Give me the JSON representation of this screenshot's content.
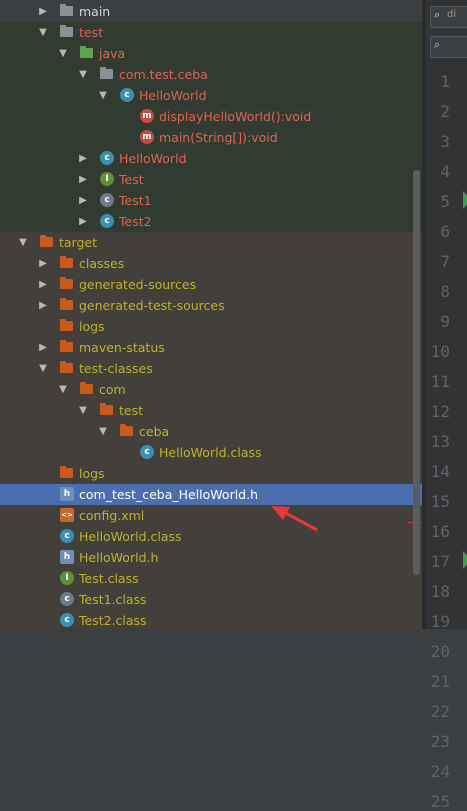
{
  "tree": {
    "rows": [
      {
        "label": "main",
        "kind": "folder-gray",
        "color": "white",
        "indent": 0,
        "arrow": "right"
      },
      {
        "label": "test",
        "kind": "folder-gray",
        "color": "red",
        "indent": 0,
        "arrow": "down"
      },
      {
        "label": "java",
        "kind": "folder-green",
        "color": "red",
        "indent": 1,
        "arrow": "down"
      },
      {
        "label": "com.test.ceba",
        "kind": "package",
        "color": "red",
        "indent": 2,
        "arrow": "down"
      },
      {
        "label": "HelloWorld",
        "kind": "class",
        "color": "red",
        "indent": 3,
        "arrow": "down"
      },
      {
        "label": "displayHelloWorld():void",
        "kind": "method",
        "color": "red",
        "indent": 4,
        "arrow": ""
      },
      {
        "label": "main(String[]):void",
        "kind": "method",
        "color": "red",
        "indent": 4,
        "arrow": ""
      },
      {
        "label": "HelloWorld",
        "kind": "class",
        "color": "red",
        "indent": 3,
        "arrow": "right",
        "indent_override": 2
      },
      {
        "label": "Test",
        "kind": "interface",
        "color": "red",
        "indent": 2,
        "arrow": "right"
      },
      {
        "label": "Test1",
        "kind": "abstract",
        "color": "red",
        "indent": 2,
        "arrow": "right"
      },
      {
        "label": "Test2",
        "kind": "class",
        "color": "red",
        "indent": 2,
        "arrow": "right"
      },
      {
        "label": "target",
        "kind": "folder-orange",
        "color": "olive",
        "indent": -1,
        "arrow": "down"
      },
      {
        "label": "classes",
        "kind": "folder-orange",
        "color": "olive",
        "indent": 0,
        "arrow": "right"
      },
      {
        "label": "generated-sources",
        "kind": "folder-orange",
        "color": "olive",
        "indent": 0,
        "arrow": "right"
      },
      {
        "label": "generated-test-sources",
        "kind": "folder-orange",
        "color": "olive",
        "indent": 0,
        "arrow": "right"
      },
      {
        "label": "logs",
        "kind": "folder-orange",
        "color": "olive",
        "indent": 0,
        "arrow": ""
      },
      {
        "label": "maven-status",
        "kind": "folder-orange",
        "color": "olive",
        "indent": 0,
        "arrow": "right"
      },
      {
        "label": "test-classes",
        "kind": "folder-orange",
        "color": "olive",
        "indent": 0,
        "arrow": "down"
      },
      {
        "label": "com",
        "kind": "folder-orange",
        "color": "olive",
        "indent": 1,
        "arrow": "down"
      },
      {
        "label": "test",
        "kind": "folder-orange",
        "color": "olive",
        "indent": 2,
        "arrow": "down"
      },
      {
        "label": "ceba",
        "kind": "folder-orange",
        "color": "olive",
        "indent": 3,
        "arrow": "down"
      },
      {
        "label": "HelloWorld.class",
        "kind": "class-file",
        "color": "olive",
        "indent": 4,
        "arrow": ""
      },
      {
        "label": "logs",
        "kind": "folder-orange",
        "color": "olive",
        "indent": 0,
        "arrow": ""
      },
      {
        "label": "com_test_ceba_HelloWorld.h",
        "kind": "h-file",
        "color": "sel",
        "indent": 0,
        "arrow": "",
        "selected": true
      },
      {
        "label": "config.xml",
        "kind": "xml-file",
        "color": "olive",
        "indent": 0,
        "arrow": ""
      },
      {
        "label": "HelloWorld.class",
        "kind": "class-file",
        "color": "olive",
        "indent": 0,
        "arrow": ""
      },
      {
        "label": "HelloWorld.h",
        "kind": "h-file",
        "color": "olive",
        "indent": 0,
        "arrow": ""
      },
      {
        "label": "Test.class",
        "kind": "interface-file",
        "color": "olive",
        "indent": 0,
        "arrow": ""
      },
      {
        "label": "Test1.class",
        "kind": "abstract-file",
        "color": "olive",
        "indent": 0,
        "arrow": ""
      },
      {
        "label": "Test2.class",
        "kind": "class-file",
        "color": "olive",
        "indent": 0,
        "arrow": ""
      }
    ]
  },
  "editor": {
    "line_numbers": [
      "1",
      "2",
      "3",
      "4",
      "5",
      "6",
      "7",
      "8",
      "9",
      "10",
      "11",
      "12",
      "13",
      "14",
      "15",
      "16",
      "17",
      "18",
      "19",
      "20",
      "21",
      "22",
      "23",
      "24",
      "25"
    ],
    "toolbar_text": "di"
  },
  "colors": {
    "selection": "#4b6eaf",
    "modified_red": "#e06355",
    "excluded_olive": "#bbb529",
    "annotation_arrow": "#e53935"
  }
}
